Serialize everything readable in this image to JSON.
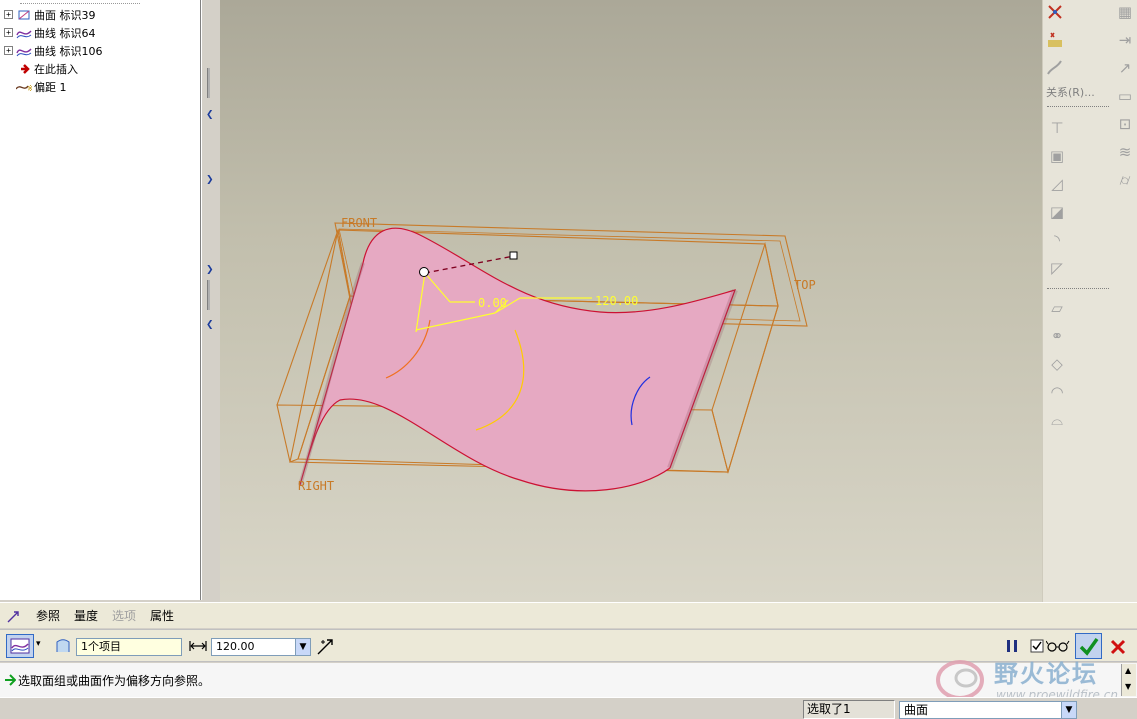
{
  "model_tree": {
    "items": [
      {
        "icon": "surface-icon",
        "label": "曲面 标识39",
        "expandable": true
      },
      {
        "icon": "curve-icon",
        "label": "曲线 标识64",
        "expandable": true
      },
      {
        "icon": "curve-icon",
        "label": "曲线 标识106",
        "expandable": true
      },
      {
        "icon": "insert-here-arrow-icon",
        "label": "在此插入",
        "expandable": false
      },
      {
        "icon": "offset-icon",
        "label": "偏距 1",
        "expandable": false
      }
    ]
  },
  "viewport": {
    "datum_front": "FRONT",
    "datum_top": "TOP",
    "datum_right": "RIGHT",
    "dim_offset": "0.00",
    "dim_length": "120.00",
    "colors": {
      "surface": "#e6a9c2",
      "surface_edge": "#cc1133",
      "datum": "#c87a28",
      "dimension": "#ffff30"
    }
  },
  "right_toolbar": {
    "relations_label": "关系(R)..."
  },
  "dashboard": {
    "tabs": [
      {
        "label": "参照",
        "enabled": true
      },
      {
        "label": "量度",
        "enabled": true
      },
      {
        "label": "选项",
        "enabled": false
      },
      {
        "label": "属性",
        "enabled": true
      }
    ],
    "reference_value": "1个项目",
    "length_value": "120.00"
  },
  "message": "选取面组或曲面作为偏移方向参照。",
  "status": {
    "selected": "选取了1",
    "filter": "曲面"
  },
  "watermark": {
    "title": "野火论坛",
    "url": "www.proewildfire.cn"
  }
}
